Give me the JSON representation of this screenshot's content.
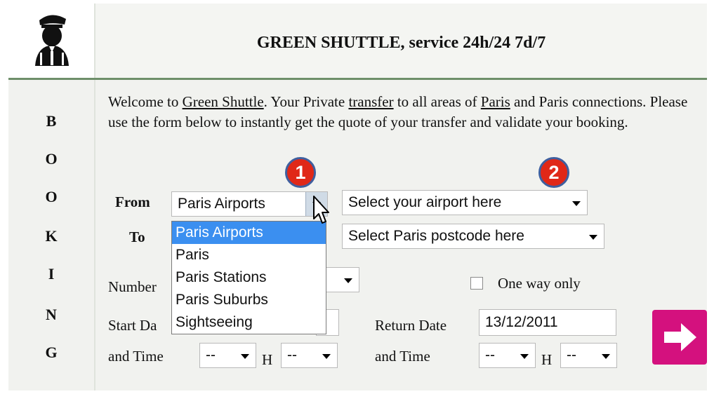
{
  "header": {
    "title": "GREEN SHUTTLE, service 24h/24 7d/7"
  },
  "booking_letters": [
    "B",
    "O",
    "O",
    "K",
    "I",
    "N",
    "G"
  ],
  "welcome": {
    "part1": "Welcome to ",
    "link_green_shuttle": "Green Shuttle",
    "part2": ". Your Private ",
    "link_transfer": "transfer",
    "part3": " to all areas of ",
    "link_paris": "Paris",
    "part4": " and Paris connections. Please use the form below to instantly get the quote of your transfer and validate your booking."
  },
  "annotations": {
    "badge1": "1",
    "badge2": "2"
  },
  "form": {
    "from_label": "From",
    "to_label": "To",
    "from_type_value": "Paris Airports",
    "from_place_value": "Select your airport here",
    "to_place_value": "Select Paris postcode here",
    "from_type_options": [
      "Paris Airports",
      "Paris",
      "Paris Stations",
      "Paris Suburbs",
      "Sightseeing"
    ],
    "number_label_visible": "Number",
    "one_way_label": "One way only",
    "start_date_label_visible": "Start Da",
    "and_time_label": "and Time",
    "return_date_label": "Return Date",
    "return_date_value": "13/12/2011",
    "hour_placeholder": "--",
    "minute_placeholder": "--",
    "h_separator": "H"
  },
  "colors": {
    "header_rule": "#6e8f6a",
    "dropdown_highlight": "#3b8ff0",
    "go_button": "#d4117e",
    "badge_fill": "#e02818"
  },
  "icons": {
    "logo": "chauffeur-icon",
    "submit": "arrow-right-icon"
  }
}
